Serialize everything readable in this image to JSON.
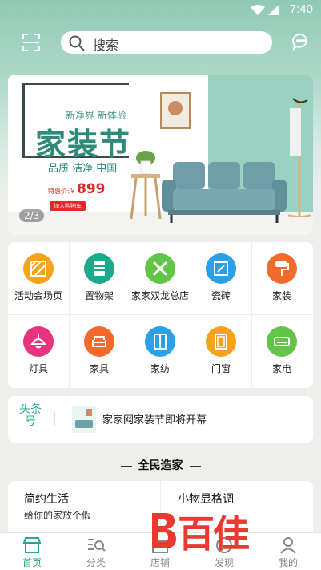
{
  "status_bar": {
    "time": "7:40"
  },
  "search": {
    "placeholder": "搜索"
  },
  "banner": {
    "subtitle": "新净界 新体验",
    "title": "家装节",
    "tagline": "品质 洁净 中国",
    "price_label": "特惠价:￥",
    "price": "899",
    "cart_label": "加入购物车",
    "indicator": "2/3"
  },
  "categories": [
    {
      "label": "活动会场页",
      "icon": "activity-icon",
      "color": "#f6a31b"
    },
    {
      "label": "置物架",
      "icon": "shelf-icon",
      "color": "#1fa98c"
    },
    {
      "label": "家家双龙总店",
      "icon": "tools-icon",
      "color": "#63c44a"
    },
    {
      "label": "瓷砖",
      "icon": "tile-icon",
      "color": "#2aa0e6"
    },
    {
      "label": "家装",
      "icon": "paint-roller-icon",
      "color": "#f46a2a"
    },
    {
      "label": "灯具",
      "icon": "lamp-icon",
      "color": "#e8337e"
    },
    {
      "label": "家具",
      "icon": "sofa-icon",
      "color": "#f46a2a"
    },
    {
      "label": "家纺",
      "icon": "wardrobe-icon",
      "color": "#2aa0e6"
    },
    {
      "label": "门窗",
      "icon": "door-icon",
      "color": "#f6a31b"
    },
    {
      "label": "家电",
      "icon": "air-conditioner-icon",
      "color": "#63c44a"
    }
  ],
  "news": {
    "tag": "头条号",
    "text": "家家网家装节即将开幕"
  },
  "section": {
    "title": "全民造家"
  },
  "cards": [
    {
      "title": "简约生活",
      "subtitle": "给你的家放个假"
    },
    {
      "title": "小物显格调",
      "subtitle": ""
    }
  ],
  "tabs": [
    {
      "label": "首页",
      "icon": "home-icon"
    },
    {
      "label": "分类",
      "icon": "category-icon"
    },
    {
      "label": "店铺",
      "icon": "store-icon"
    },
    {
      "label": "发现",
      "icon": "discover-icon"
    },
    {
      "label": "我的",
      "icon": "profile-icon"
    }
  ],
  "watermark": {
    "text": "百佳"
  },
  "colors": {
    "accent": "#2aa58d",
    "price": "#e02a2a",
    "watermark": "#e83a30"
  }
}
